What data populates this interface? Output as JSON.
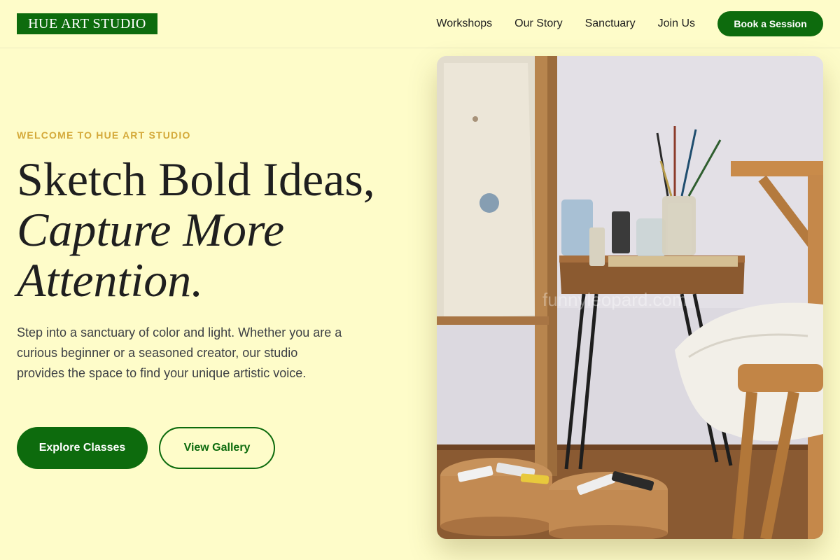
{
  "header": {
    "logo": "HUE ART STUDIO",
    "nav": [
      "Workshops",
      "Our Story",
      "Sanctuary",
      "Join Us"
    ],
    "cta": "Book a Session"
  },
  "hero": {
    "eyebrow": "WELCOME TO HUE ART STUDIO",
    "headline_line1": "Sketch Bold Ideas,",
    "headline_line2": "Capture More",
    "headline_line3": "Attention.",
    "description": "Step into a sanctuary of color and light. Whether you are a curious beginner or a seasoned creator, our studio provides the space to find your unique artistic voice.",
    "primary_button": "Explore Classes",
    "secondary_button": "View Gallery",
    "image_watermark": "funnyleopard.com"
  },
  "colors": {
    "background": "#fefcc9",
    "brand_green": "#0d6b0d",
    "accent_gold": "#d4a93a"
  }
}
